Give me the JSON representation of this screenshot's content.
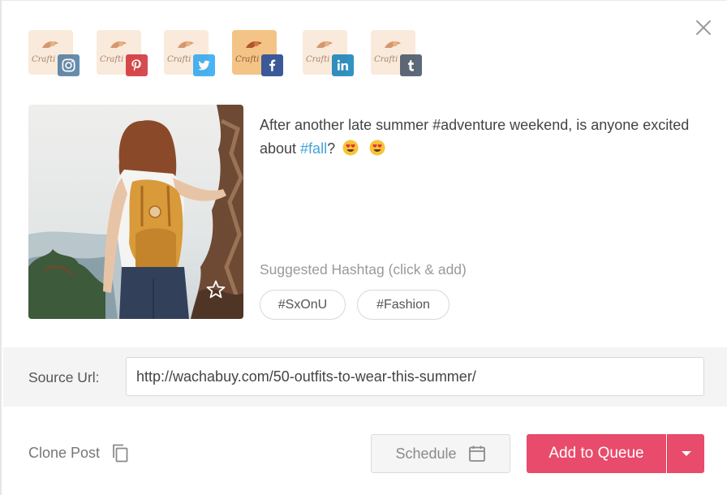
{
  "accounts": [
    {
      "network": "instagram",
      "icon": "instagram-icon",
      "selected": false,
      "avatar_text": "Crafti"
    },
    {
      "network": "pinterest",
      "icon": "pinterest-icon",
      "selected": false,
      "avatar_text": "Crafti"
    },
    {
      "network": "twitter",
      "icon": "twitter-icon",
      "selected": false,
      "avatar_text": "Crafti"
    },
    {
      "network": "facebook",
      "icon": "facebook-icon",
      "selected": true,
      "avatar_text": "Crafti"
    },
    {
      "network": "linkedin",
      "icon": "linkedin-icon",
      "selected": false,
      "avatar_text": "Crafti"
    },
    {
      "network": "tumblr",
      "icon": "tumblr-icon",
      "selected": false,
      "avatar_text": "Crafti"
    }
  ],
  "colors": {
    "instagram": "#3f729b",
    "pinterest": "#cb2027",
    "twitter": "#1da1f2",
    "facebook": "#3b5998",
    "linkedin": "#0077b5",
    "tumblr": "#35465c",
    "hashtag": "#3ea3da",
    "primary_button": "#e84b6b"
  },
  "post": {
    "caption_before": "After another late summer #adventure weekend, is anyone excited about ",
    "caption_hashtag": "#fall",
    "caption_after": "?",
    "emojis": [
      "heart-eyes-emoji",
      "heart-eyes-emoji"
    ],
    "image_icon": "star-icon"
  },
  "suggested": {
    "label": "Suggested Hashtag (click & add)",
    "tags": [
      "#SxOnU",
      "#Fashion"
    ]
  },
  "source": {
    "label": "Source Url:",
    "value": "http://wachabuy.com/50-outfits-to-wear-this-summer/"
  },
  "footer": {
    "clone_label": "Clone Post",
    "schedule_label": "Schedule",
    "queue_label": "Add to Queue"
  }
}
